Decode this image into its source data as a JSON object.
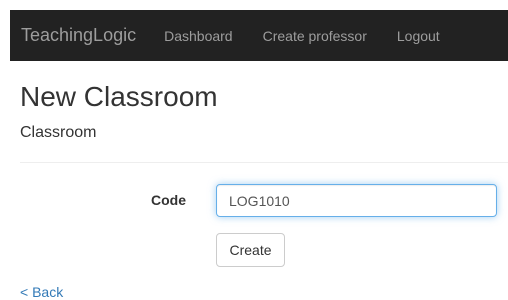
{
  "navbar": {
    "brand": "TeachingLogic",
    "links": [
      "Dashboard",
      "Create professor",
      "Logout"
    ]
  },
  "page": {
    "title": "New Classroom",
    "subtitle": "Classroom"
  },
  "form": {
    "code_label": "Code",
    "code_value": "LOG1010",
    "submit_label": "Create"
  },
  "back_link": "< Back",
  "colors": {
    "navbar_bg": "#222222",
    "link": "#337ab7",
    "focus_border": "#66afe9"
  }
}
